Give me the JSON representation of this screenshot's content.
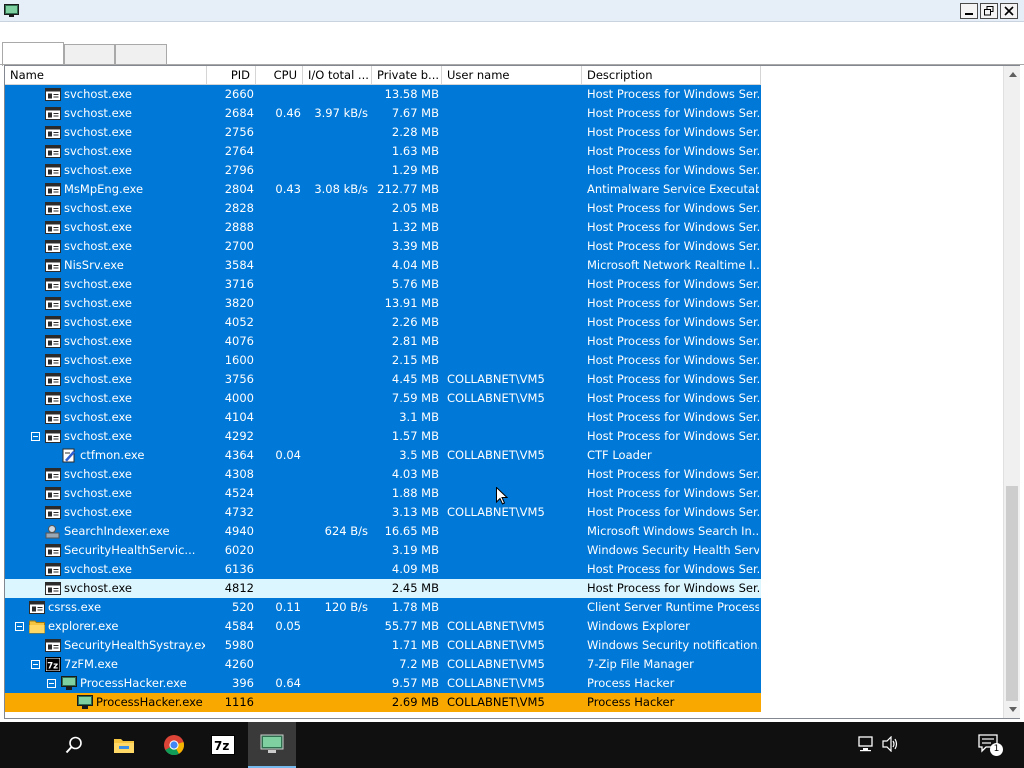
{
  "columns": [
    {
      "label": "Name"
    },
    {
      "label": "PID"
    },
    {
      "label": "CPU"
    },
    {
      "label": "I/O total ..."
    },
    {
      "label": "Private b..."
    },
    {
      "label": "User name"
    },
    {
      "label": "Description"
    }
  ],
  "rows": [
    {
      "name": "svchost.exe",
      "pid": "2660",
      "cpu": "",
      "io": "",
      "priv": "13.58 MB",
      "user": "",
      "desc": "Host Process for Windows Ser...",
      "icon": "service-icon",
      "indent": 2,
      "expander": false,
      "state": "normal"
    },
    {
      "name": "svchost.exe",
      "pid": "2684",
      "cpu": "0.46",
      "io": "3.97 kB/s",
      "priv": "7.67 MB",
      "user": "",
      "desc": "Host Process for Windows Ser...",
      "icon": "service-icon",
      "indent": 2,
      "expander": false,
      "state": "normal"
    },
    {
      "name": "svchost.exe",
      "pid": "2756",
      "cpu": "",
      "io": "",
      "priv": "2.28 MB",
      "user": "",
      "desc": "Host Process for Windows Ser...",
      "icon": "service-icon",
      "indent": 2,
      "expander": false,
      "state": "normal"
    },
    {
      "name": "svchost.exe",
      "pid": "2764",
      "cpu": "",
      "io": "",
      "priv": "1.63 MB",
      "user": "",
      "desc": "Host Process for Windows Ser...",
      "icon": "service-icon",
      "indent": 2,
      "expander": false,
      "state": "normal"
    },
    {
      "name": "svchost.exe",
      "pid": "2796",
      "cpu": "",
      "io": "",
      "priv": "1.29 MB",
      "user": "",
      "desc": "Host Process for Windows Ser...",
      "icon": "service-icon",
      "indent": 2,
      "expander": false,
      "state": "normal"
    },
    {
      "name": "MsMpEng.exe",
      "pid": "2804",
      "cpu": "0.43",
      "io": "3.08 kB/s",
      "priv": "212.77 MB",
      "user": "",
      "desc": "Antimalware Service Executable",
      "icon": "service-icon",
      "indent": 2,
      "expander": false,
      "state": "normal"
    },
    {
      "name": "svchost.exe",
      "pid": "2828",
      "cpu": "",
      "io": "",
      "priv": "2.05 MB",
      "user": "",
      "desc": "Host Process for Windows Ser...",
      "icon": "service-icon",
      "indent": 2,
      "expander": false,
      "state": "normal"
    },
    {
      "name": "svchost.exe",
      "pid": "2888",
      "cpu": "",
      "io": "",
      "priv": "1.32 MB",
      "user": "",
      "desc": "Host Process for Windows Ser...",
      "icon": "service-icon",
      "indent": 2,
      "expander": false,
      "state": "normal"
    },
    {
      "name": "svchost.exe",
      "pid": "2700",
      "cpu": "",
      "io": "",
      "priv": "3.39 MB",
      "user": "",
      "desc": "Host Process for Windows Ser...",
      "icon": "service-icon",
      "indent": 2,
      "expander": false,
      "state": "normal"
    },
    {
      "name": "NisSrv.exe",
      "pid": "3584",
      "cpu": "",
      "io": "",
      "priv": "4.04 MB",
      "user": "",
      "desc": "Microsoft Network Realtime I...",
      "icon": "service-icon",
      "indent": 2,
      "expander": false,
      "state": "normal"
    },
    {
      "name": "svchost.exe",
      "pid": "3716",
      "cpu": "",
      "io": "",
      "priv": "5.76 MB",
      "user": "",
      "desc": "Host Process for Windows Ser...",
      "icon": "service-icon",
      "indent": 2,
      "expander": false,
      "state": "normal"
    },
    {
      "name": "svchost.exe",
      "pid": "3820",
      "cpu": "",
      "io": "",
      "priv": "13.91 MB",
      "user": "",
      "desc": "Host Process for Windows Ser...",
      "icon": "service-icon",
      "indent": 2,
      "expander": false,
      "state": "normal"
    },
    {
      "name": "svchost.exe",
      "pid": "4052",
      "cpu": "",
      "io": "",
      "priv": "2.26 MB",
      "user": "",
      "desc": "Host Process for Windows Ser...",
      "icon": "service-icon",
      "indent": 2,
      "expander": false,
      "state": "normal"
    },
    {
      "name": "svchost.exe",
      "pid": "4076",
      "cpu": "",
      "io": "",
      "priv": "2.81 MB",
      "user": "",
      "desc": "Host Process for Windows Ser...",
      "icon": "service-icon",
      "indent": 2,
      "expander": false,
      "state": "normal"
    },
    {
      "name": "svchost.exe",
      "pid": "1600",
      "cpu": "",
      "io": "",
      "priv": "2.15 MB",
      "user": "",
      "desc": "Host Process for Windows Ser...",
      "icon": "service-icon",
      "indent": 2,
      "expander": false,
      "state": "normal"
    },
    {
      "name": "svchost.exe",
      "pid": "3756",
      "cpu": "",
      "io": "",
      "priv": "4.45 MB",
      "user": "COLLABNET\\VM5",
      "desc": "Host Process for Windows Ser...",
      "icon": "service-icon",
      "indent": 2,
      "expander": false,
      "state": "normal"
    },
    {
      "name": "svchost.exe",
      "pid": "4000",
      "cpu": "",
      "io": "",
      "priv": "7.59 MB",
      "user": "COLLABNET\\VM5",
      "desc": "Host Process for Windows Ser...",
      "icon": "service-icon",
      "indent": 2,
      "expander": false,
      "state": "normal"
    },
    {
      "name": "svchost.exe",
      "pid": "4104",
      "cpu": "",
      "io": "",
      "priv": "3.1 MB",
      "user": "",
      "desc": "Host Process for Windows Ser...",
      "icon": "service-icon",
      "indent": 2,
      "expander": false,
      "state": "normal"
    },
    {
      "name": "svchost.exe",
      "pid": "4292",
      "cpu": "",
      "io": "",
      "priv": "1.57 MB",
      "user": "",
      "desc": "Host Process for Windows Ser...",
      "icon": "service-icon",
      "indent": 2,
      "expander": true,
      "state": "normal"
    },
    {
      "name": "ctfmon.exe",
      "pid": "4364",
      "cpu": "0.04",
      "io": "",
      "priv": "3.5 MB",
      "user": "COLLABNET\\VM5",
      "desc": "CTF Loader",
      "icon": "notepad-icon",
      "indent": 3,
      "expander": false,
      "state": "normal"
    },
    {
      "name": "svchost.exe",
      "pid": "4308",
      "cpu": "",
      "io": "",
      "priv": "4.03 MB",
      "user": "",
      "desc": "Host Process for Windows Ser...",
      "icon": "service-icon",
      "indent": 2,
      "expander": false,
      "state": "normal"
    },
    {
      "name": "svchost.exe",
      "pid": "4524",
      "cpu": "",
      "io": "",
      "priv": "1.88 MB",
      "user": "",
      "desc": "Host Process for Windows Ser...",
      "icon": "service-icon",
      "indent": 2,
      "expander": false,
      "state": "normal"
    },
    {
      "name": "svchost.exe",
      "pid": "4732",
      "cpu": "",
      "io": "",
      "priv": "3.13 MB",
      "user": "COLLABNET\\VM5",
      "desc": "Host Process for Windows Ser...",
      "icon": "service-icon",
      "indent": 2,
      "expander": false,
      "state": "normal"
    },
    {
      "name": "SearchIndexer.exe",
      "pid": "4940",
      "cpu": "",
      "io": "624 B/s",
      "priv": "16.65 MB",
      "user": "",
      "desc": "Microsoft Windows Search In...",
      "icon": "search-indexer-icon",
      "indent": 2,
      "expander": false,
      "state": "normal"
    },
    {
      "name": "SecurityHealthServic...",
      "pid": "6020",
      "cpu": "",
      "io": "",
      "priv": "3.19 MB",
      "user": "",
      "desc": "Windows Security Health Serv...",
      "icon": "service-icon",
      "indent": 2,
      "expander": false,
      "state": "normal"
    },
    {
      "name": "svchost.exe",
      "pid": "6136",
      "cpu": "",
      "io": "",
      "priv": "4.09 MB",
      "user": "",
      "desc": "Host Process for Windows Ser...",
      "icon": "service-icon",
      "indent": 2,
      "expander": false,
      "state": "normal"
    },
    {
      "name": "svchost.exe",
      "pid": "4812",
      "cpu": "",
      "io": "",
      "priv": "2.45 MB",
      "user": "",
      "desc": "Host Process for Windows Ser...",
      "icon": "service-icon",
      "indent": 2,
      "expander": false,
      "state": "highlight"
    },
    {
      "name": "csrss.exe",
      "pid": "520",
      "cpu": "0.11",
      "io": "120 B/s",
      "priv": "1.78 MB",
      "user": "",
      "desc": "Client Server Runtime Process",
      "icon": "service-icon",
      "indent": 1,
      "expander": false,
      "state": "normal"
    },
    {
      "name": "explorer.exe",
      "pid": "4584",
      "cpu": "0.05",
      "io": "",
      "priv": "55.77 MB",
      "user": "COLLABNET\\VM5",
      "desc": "Windows Explorer",
      "icon": "folder-icon",
      "indent": 1,
      "expander": true,
      "state": "normal"
    },
    {
      "name": "SecurityHealthSystray.exe",
      "pid": "5980",
      "cpu": "",
      "io": "",
      "priv": "1.71 MB",
      "user": "COLLABNET\\VM5",
      "desc": "Windows Security notification...",
      "icon": "service-icon",
      "indent": 2,
      "expander": false,
      "state": "normal"
    },
    {
      "name": "7zFM.exe",
      "pid": "4260",
      "cpu": "",
      "io": "",
      "priv": "7.2 MB",
      "user": "COLLABNET\\VM5",
      "desc": "7-Zip File Manager",
      "icon": "seven-zip-icon",
      "indent": 2,
      "expander": true,
      "state": "normal"
    },
    {
      "name": "ProcessHacker.exe",
      "pid": "396",
      "cpu": "0.64",
      "io": "",
      "priv": "9.57 MB",
      "user": "COLLABNET\\VM5",
      "desc": "Process Hacker",
      "icon": "process-hacker-icon",
      "indent": 3,
      "expander": true,
      "state": "normal"
    },
    {
      "name": "ProcessHacker.exe",
      "pid": "1116",
      "cpu": "",
      "io": "",
      "priv": "2.69 MB",
      "user": "COLLABNET\\VM5",
      "desc": "Process Hacker",
      "icon": "process-hacker-icon",
      "indent": 4,
      "expander": false,
      "state": "selected"
    }
  ],
  "window": {
    "minimize": "_",
    "restore": "❐",
    "close": "✕"
  },
  "taskbar": {
    "items": [
      {
        "name": "search-icon"
      },
      {
        "name": "file-explorer-icon"
      },
      {
        "name": "chrome-icon"
      },
      {
        "name": "seven-zip-icon"
      },
      {
        "name": "process-hacker-icon"
      }
    ],
    "notification_count": "1"
  },
  "colors": {
    "row_bg": "#0078d7",
    "highlight_bg": "#dcf6ff",
    "selected_bg": "#f9a800"
  }
}
